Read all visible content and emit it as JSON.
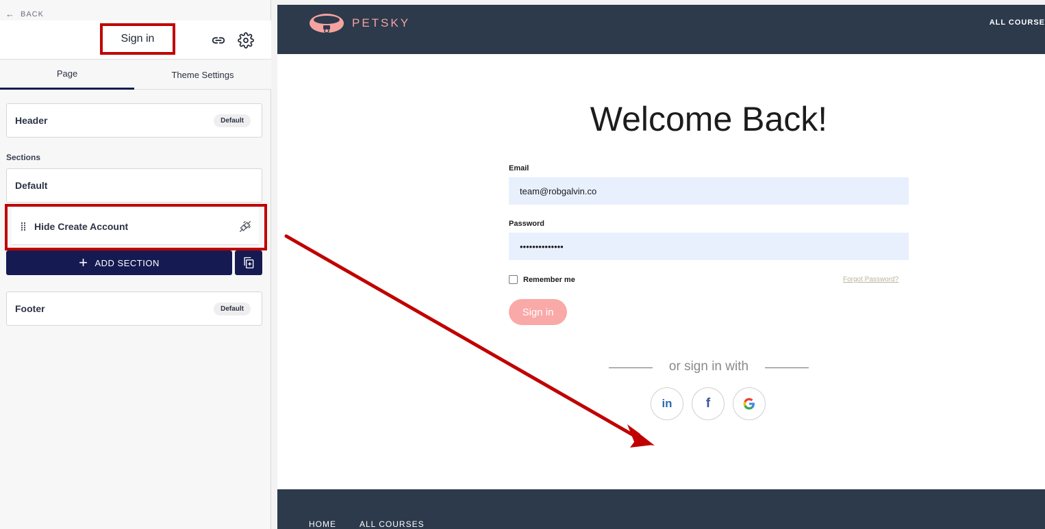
{
  "editor": {
    "back_label": "BACK",
    "page_title": "Sign in",
    "tabs": [
      {
        "label": "Page",
        "active": true
      },
      {
        "label": "Theme Settings",
        "active": false
      }
    ],
    "header_card": {
      "label": "Header",
      "badge": "Default"
    },
    "sections_label": "Sections",
    "sections": [
      {
        "label": "Default"
      },
      {
        "label": "Hide Create Account"
      }
    ],
    "add_section_label": "ADD SECTION",
    "footer_card": {
      "label": "Footer",
      "badge": "Default"
    }
  },
  "preview": {
    "brand": "PETSKY",
    "nav_top": "ALL COURSE",
    "heading": "Welcome Back!",
    "email_label": "Email",
    "email_value": "team@robgalvin.co",
    "password_label": "Password",
    "password_value": "••••••••••••••",
    "remember_label": "Remember me",
    "forgot_label": "Forgot Password?",
    "signin_label": "Sign in",
    "or_text": "or sign in with",
    "social": [
      "linkedin",
      "facebook",
      "google"
    ],
    "footer_nav": [
      "HOME",
      "ALL COURSES"
    ]
  },
  "colors": {
    "highlight": "#c00000",
    "navy": "#161a52",
    "site_header": "#2d3a4c",
    "brand_pink": "#f4a3a0",
    "input_bg": "#e8f0fe"
  }
}
